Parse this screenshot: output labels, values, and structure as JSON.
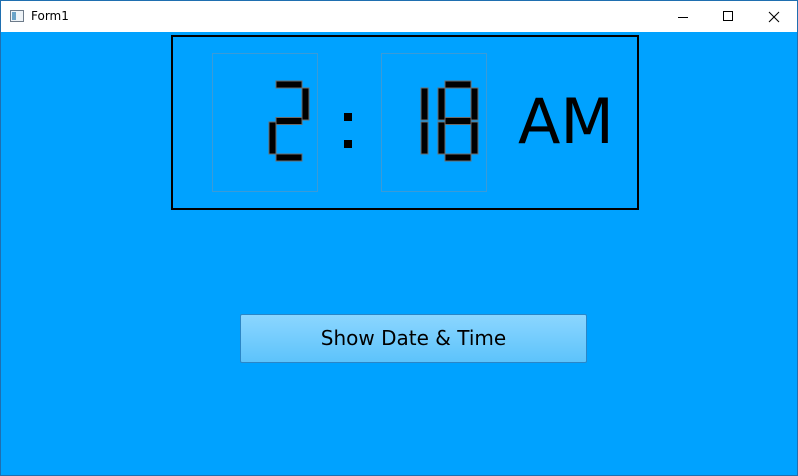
{
  "window": {
    "title": "Form1",
    "background_color": "#00a2ff"
  },
  "clock": {
    "hour": "2",
    "separator": ":",
    "minute": "18",
    "meridiem": "AM"
  },
  "actions": {
    "show_button_label": "Show Date & Time"
  }
}
